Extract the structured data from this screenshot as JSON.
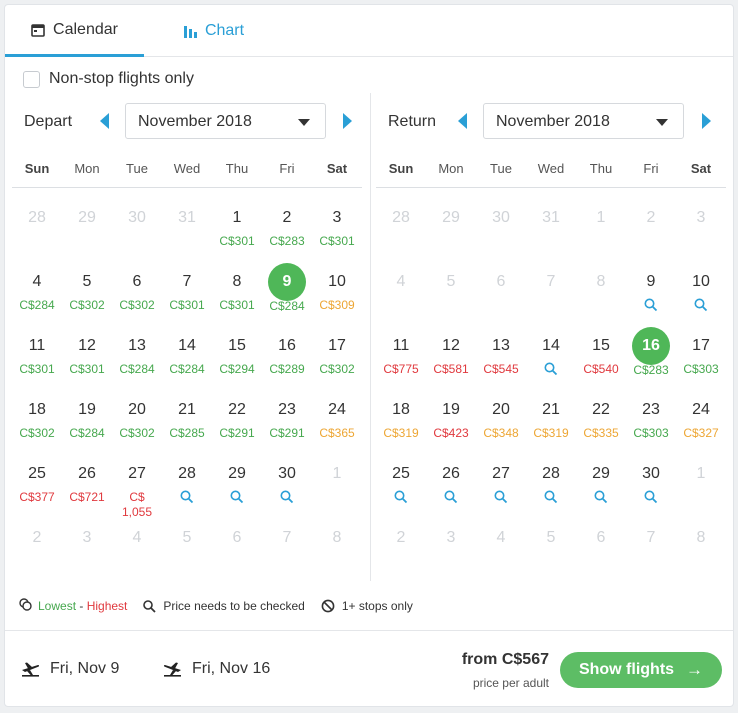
{
  "tabs": [
    {
      "label": "Calendar",
      "icon": "calendar-icon"
    },
    {
      "label": "Chart",
      "icon": "bar-chart-icon"
    }
  ],
  "nonstop_label": "Non-stop flights only",
  "depart": {
    "label": "Depart",
    "month": "November 2018",
    "days_of_week": [
      "Sun",
      "Mon",
      "Tue",
      "Wed",
      "Thu",
      "Fri",
      "Sat"
    ],
    "cells": [
      {
        "n": "28",
        "muted": true
      },
      {
        "n": "29",
        "muted": true
      },
      {
        "n": "30",
        "muted": true
      },
      {
        "n": "31",
        "muted": true
      },
      {
        "n": "1",
        "p": "C$301",
        "c": "low"
      },
      {
        "n": "2",
        "p": "C$283",
        "c": "low"
      },
      {
        "n": "3",
        "p": "C$301",
        "c": "low"
      },
      {
        "n": "4",
        "p": "C$284",
        "c": "low"
      },
      {
        "n": "5",
        "p": "C$302",
        "c": "low"
      },
      {
        "n": "6",
        "p": "C$302",
        "c": "low"
      },
      {
        "n": "7",
        "p": "C$301",
        "c": "low"
      },
      {
        "n": "8",
        "p": "C$301",
        "c": "low"
      },
      {
        "n": "9",
        "p": "C$284",
        "c": "low",
        "sel": true
      },
      {
        "n": "10",
        "p": "C$309",
        "c": "mid"
      },
      {
        "n": "11",
        "p": "C$301",
        "c": "low"
      },
      {
        "n": "12",
        "p": "C$301",
        "c": "low"
      },
      {
        "n": "13",
        "p": "C$284",
        "c": "low"
      },
      {
        "n": "14",
        "p": "C$284",
        "c": "low"
      },
      {
        "n": "15",
        "p": "C$294",
        "c": "low"
      },
      {
        "n": "16",
        "p": "C$289",
        "c": "low"
      },
      {
        "n": "17",
        "p": "C$302",
        "c": "low"
      },
      {
        "n": "18",
        "p": "C$302",
        "c": "low"
      },
      {
        "n": "19",
        "p": "C$284",
        "c": "low"
      },
      {
        "n": "20",
        "p": "C$302",
        "c": "low"
      },
      {
        "n": "21",
        "p": "C$285",
        "c": "low"
      },
      {
        "n": "22",
        "p": "C$291",
        "c": "low"
      },
      {
        "n": "23",
        "p": "C$291",
        "c": "low"
      },
      {
        "n": "24",
        "p": "C$365",
        "c": "mid"
      },
      {
        "n": "25",
        "p": "C$377",
        "c": "high"
      },
      {
        "n": "26",
        "p": "C$721",
        "c": "high"
      },
      {
        "n": "27",
        "p": "C$ 1,055",
        "c": "high"
      },
      {
        "n": "28",
        "check": true
      },
      {
        "n": "29",
        "check": true
      },
      {
        "n": "30",
        "check": true
      },
      {
        "n": "1",
        "muted": true
      },
      {
        "n": "2",
        "muted": true
      },
      {
        "n": "3",
        "muted": true
      },
      {
        "n": "4",
        "muted": true
      },
      {
        "n": "5",
        "muted": true
      },
      {
        "n": "6",
        "muted": true
      },
      {
        "n": "7",
        "muted": true
      },
      {
        "n": "8",
        "muted": true
      }
    ]
  },
  "return": {
    "label": "Return",
    "month": "November 2018",
    "days_of_week": [
      "Sun",
      "Mon",
      "Tue",
      "Wed",
      "Thu",
      "Fri",
      "Sat"
    ],
    "cells": [
      {
        "n": "28",
        "muted": true
      },
      {
        "n": "29",
        "muted": true
      },
      {
        "n": "30",
        "muted": true
      },
      {
        "n": "31",
        "muted": true
      },
      {
        "n": "1",
        "muted": true
      },
      {
        "n": "2",
        "muted": true
      },
      {
        "n": "3",
        "muted": true
      },
      {
        "n": "4",
        "muted": true
      },
      {
        "n": "5",
        "muted": true
      },
      {
        "n": "6",
        "muted": true
      },
      {
        "n": "7",
        "muted": true
      },
      {
        "n": "8",
        "muted": true
      },
      {
        "n": "9",
        "check": true
      },
      {
        "n": "10",
        "check": true
      },
      {
        "n": "11",
        "p": "C$775",
        "c": "high"
      },
      {
        "n": "12",
        "p": "C$581",
        "c": "high"
      },
      {
        "n": "13",
        "p": "C$545",
        "c": "high"
      },
      {
        "n": "14",
        "check": true
      },
      {
        "n": "15",
        "p": "C$540",
        "c": "high"
      },
      {
        "n": "16",
        "p": "C$283",
        "c": "low",
        "sel": true
      },
      {
        "n": "17",
        "p": "C$303",
        "c": "low"
      },
      {
        "n": "18",
        "p": "C$319",
        "c": "mid"
      },
      {
        "n": "19",
        "p": "C$423",
        "c": "high"
      },
      {
        "n": "20",
        "p": "C$348",
        "c": "mid"
      },
      {
        "n": "21",
        "p": "C$319",
        "c": "mid"
      },
      {
        "n": "22",
        "p": "C$335",
        "c": "mid"
      },
      {
        "n": "23",
        "p": "C$303",
        "c": "low"
      },
      {
        "n": "24",
        "p": "C$327",
        "c": "mid"
      },
      {
        "n": "25",
        "check": true
      },
      {
        "n": "26",
        "check": true
      },
      {
        "n": "27",
        "check": true
      },
      {
        "n": "28",
        "check": true
      },
      {
        "n": "29",
        "check": true
      },
      {
        "n": "30",
        "check": true
      },
      {
        "n": "1",
        "muted": true
      },
      {
        "n": "2",
        "muted": true
      },
      {
        "n": "3",
        "muted": true
      },
      {
        "n": "4",
        "muted": true
      },
      {
        "n": "5",
        "muted": true
      },
      {
        "n": "6",
        "muted": true
      },
      {
        "n": "7",
        "muted": true
      },
      {
        "n": "8",
        "muted": true
      }
    ]
  },
  "legend": {
    "lowest": "Lowest",
    "dash": " - ",
    "highest": "Highest",
    "check": "Price needs to be checked",
    "stops": "1+ stops only"
  },
  "footer": {
    "outbound": "Fri, Nov 9",
    "inbound": "Fri, Nov 16",
    "from_price": "from C$567",
    "price_note": "price per adult",
    "button": "Show flights"
  },
  "colors": {
    "accent": "#2a9fd6",
    "low": "#46a84e",
    "mid": "#eda634",
    "high": "#e0393e",
    "selected": "#4fb758",
    "button": "#5dbd65"
  }
}
